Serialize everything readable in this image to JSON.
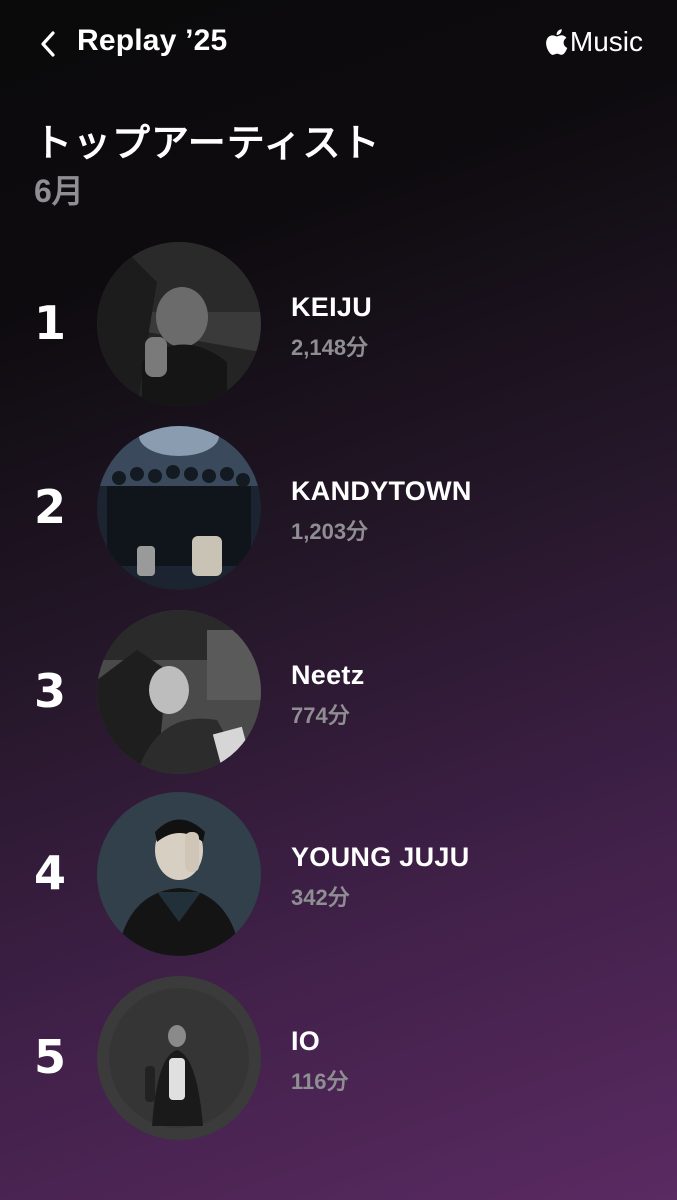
{
  "header": {
    "title": "Replay ’25",
    "brand_label": "Music"
  },
  "section": {
    "title": "トップアーティスト",
    "subtitle": "6月"
  },
  "artists": [
    {
      "rank": "1",
      "name": "KEIJU",
      "minutes": "2,148分"
    },
    {
      "rank": "2",
      "name": "KANDYTOWN",
      "minutes": "1,203分"
    },
    {
      "rank": "3",
      "name": "Neetz",
      "minutes": "774分"
    },
    {
      "rank": "4",
      "name": "YOUNG JUJU",
      "minutes": "342分"
    },
    {
      "rank": "5",
      "name": "IO",
      "minutes": "116分"
    }
  ],
  "icons": {
    "back": "chevron-left-icon",
    "brand": "apple-logo-icon"
  },
  "colors": {
    "secondary_text": "#8e8e93",
    "gradient_end": "#5a2a62"
  }
}
